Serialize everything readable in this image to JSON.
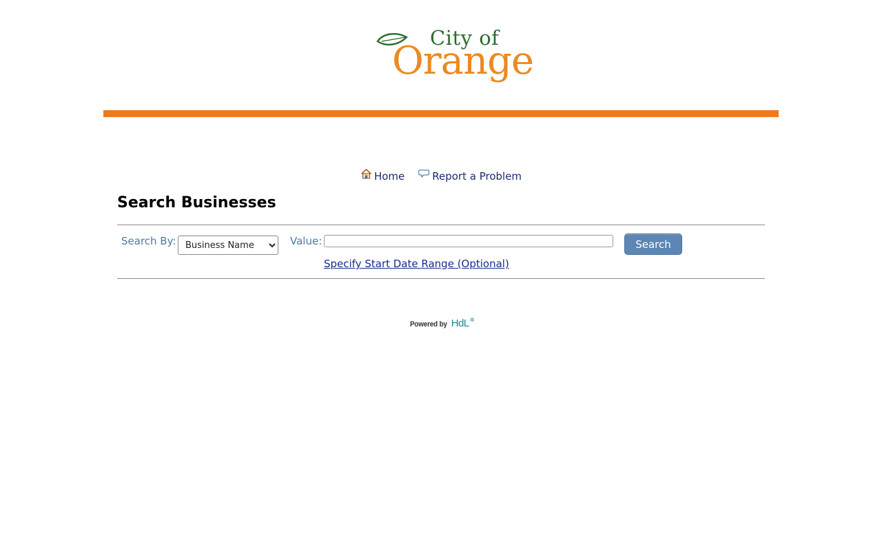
{
  "logo": {
    "line1": "City of",
    "line2": "Orange"
  },
  "nav": {
    "home_label": "Home",
    "report_label": "Report a Problem"
  },
  "page": {
    "title": "Search Businesses"
  },
  "search": {
    "search_by_label": "Search By:",
    "search_by_selected": "Business Name",
    "value_label": "Value:",
    "value_text": "",
    "button_label": "Search",
    "date_range_link": "Specify Start Date Range (Optional)"
  },
  "footer": {
    "powered_by": "Powered by",
    "brand": "HdL"
  },
  "colors": {
    "accent_bar": "#ed7a1c",
    "logo_green": "#2e6b30",
    "logo_orange": "#ec8a22",
    "button": "#5c86b4",
    "label": "#4a7aa5",
    "link": "#1a2a8c"
  },
  "icons": {
    "home": "house-icon",
    "report": "speech-bubble-icon"
  }
}
